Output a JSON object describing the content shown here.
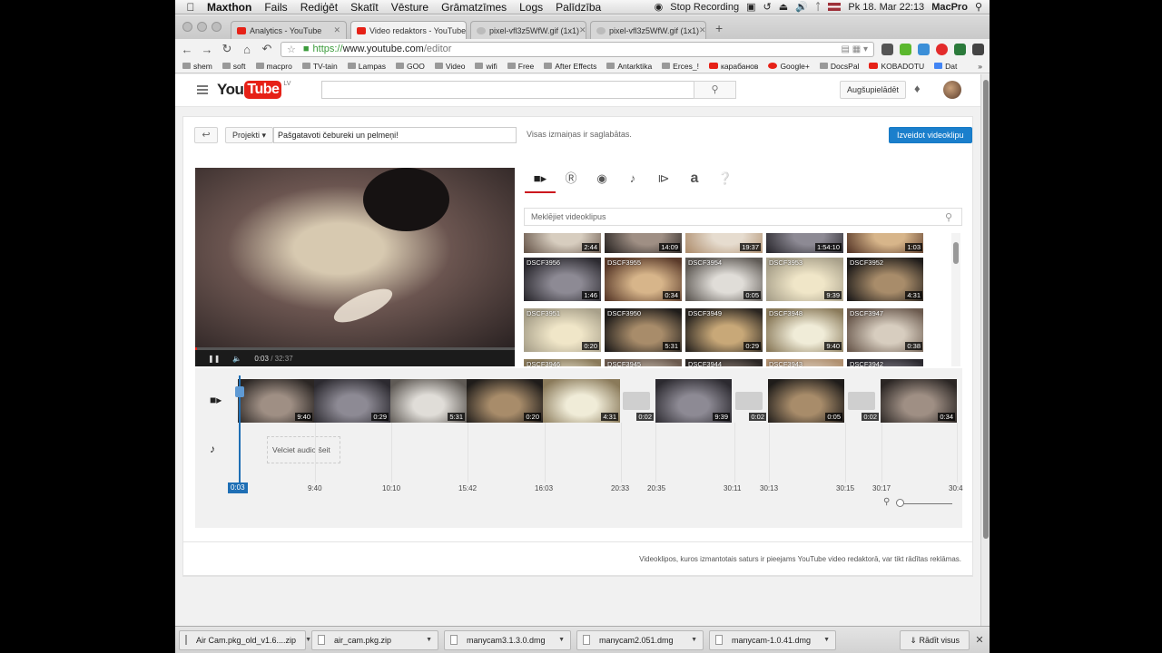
{
  "menubar": {
    "app": "Maxthon",
    "items": [
      "Fails",
      "Rediģēt",
      "Skatīt",
      "Vēsture",
      "Grāmatzīmes",
      "Logs",
      "Palīdzība"
    ],
    "stop_recording": "Stop Recording",
    "clock": "Pk 18. Mar  22:13",
    "user": "MacPro"
  },
  "tabs": [
    {
      "label": "Analytics - YouTube",
      "favicon": "youtube"
    },
    {
      "label": "Video redaktors - YouTube",
      "favicon": "youtube",
      "active": true
    },
    {
      "label": "pixel-vfl3z5WfW.gif (1x1)",
      "favicon": "globe"
    },
    {
      "label": "pixel-vfl3z5WfW.gif (1x1)",
      "favicon": "globe"
    }
  ],
  "address": {
    "scheme": "https://",
    "host": "www.youtube.com",
    "path": "/editor"
  },
  "bookmarks": [
    "shem",
    "soft",
    "macpro",
    "TV-tain",
    "Lampas",
    "GOO",
    "Video",
    "wifi",
    "Free",
    "After Effects",
    "Antarktika",
    "Erces_!",
    "карабанов",
    "Google+",
    "DocsPal",
    "KOBADOTU",
    "Dat"
  ],
  "youtube": {
    "logo_you": "You",
    "logo_tube": "Tube",
    "region": "LV",
    "upload_label": "Augšupielādēt"
  },
  "editor": {
    "projects_label": "Projekti",
    "project_title": "Pašgatavoti čebureki un pelmeņi!",
    "saved_status": "Visas izmaiņas ir saglabātas.",
    "create_label": "Izveidot videoklipu",
    "player": {
      "current": "0:03",
      "duration": "/ 32:37",
      "progress": 0.002
    },
    "media_tabs": [
      "video-camera-icon",
      "cc-icon",
      "photo-camera-icon",
      "music-note-icon",
      "transition-icon",
      "text-icon",
      "help-icon"
    ],
    "search_placeholder": "Meklējiet videoklipus",
    "clips_row0": [
      {
        "name": "",
        "dur": "2:44"
      },
      {
        "name": "",
        "dur": "14:09"
      },
      {
        "name": "",
        "dur": "19:37"
      },
      {
        "name": "",
        "dur": "1:54:10"
      },
      {
        "name": "",
        "dur": "1:03"
      }
    ],
    "clips_row1": [
      {
        "name": "DSCF3956",
        "dur": "1:46"
      },
      {
        "name": "DSCF3955",
        "dur": "0:34"
      },
      {
        "name": "DSCF3954",
        "dur": "0:05"
      },
      {
        "name": "DSCF3953",
        "dur": "9:39"
      },
      {
        "name": "DSCF3952",
        "dur": "4:31"
      }
    ],
    "clips_row2": [
      {
        "name": "DSCF3951",
        "dur": "0:20"
      },
      {
        "name": "DSCF3950",
        "dur": "5:31"
      },
      {
        "name": "DSCF3949",
        "dur": "0:29"
      },
      {
        "name": "DSCF3948",
        "dur": "9:40"
      },
      {
        "name": "DSCF3947",
        "dur": "0:38"
      }
    ],
    "clips_row3": [
      {
        "name": "DSCF3946",
        "dur": ""
      },
      {
        "name": "DSCF3945",
        "dur": ""
      },
      {
        "name": "DSCF3944",
        "dur": ""
      },
      {
        "name": "DSCF3943",
        "dur": ""
      },
      {
        "name": "DSCF3942",
        "dur": ""
      }
    ],
    "timeline_clips": [
      "9:40",
      "0:29",
      "5:31",
      "0:20",
      "4:31",
      "0:02",
      "9:39",
      "0:02",
      "0:05",
      "0:02",
      "0:34"
    ],
    "audio_drop": "Velciet audio šeit",
    "ruler": [
      "0:03",
      "9:40",
      "10:10",
      "15:42",
      "16:03",
      "20:33",
      "20:35",
      "30:11",
      "30:13",
      "30:15",
      "30:17",
      "30:4"
    ],
    "footnote": "Videoklipos, kuros izmantotais saturs ir pieejams YouTube video redaktorā, var tikt rādītas reklāmas."
  },
  "downloads": {
    "items": [
      "Air Cam.pkg_old_v1.6....zip",
      "air_cam.pkg.zip",
      "manycam3.1.3.0.dmg",
      "manycam2.051.dmg",
      "manycam-1.0.41.dmg"
    ],
    "show_all": "Rādīt visus"
  },
  "colors": {
    "youtube_red": "#e62117",
    "create_blue": "#1b7fcc",
    "playhead_blue": "#1f6fb5"
  }
}
